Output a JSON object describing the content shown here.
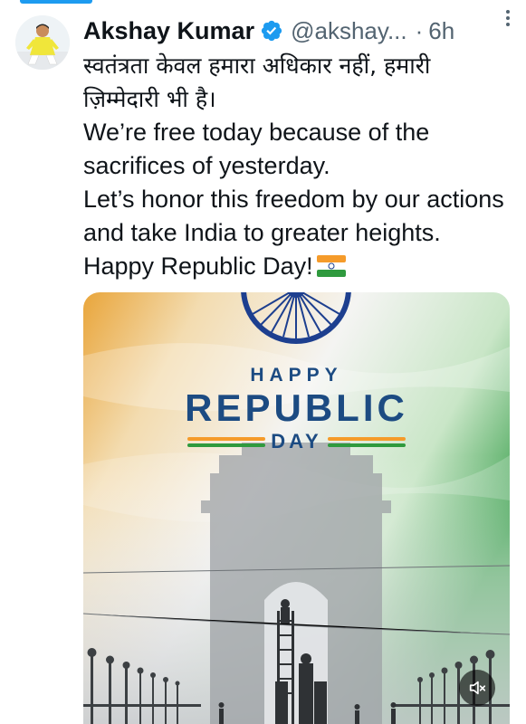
{
  "tweet": {
    "author": {
      "display_name": "Akshay Kumar",
      "handle": "@akshay...",
      "verified": true,
      "avatar_icon": "profile-photo"
    },
    "separator": "·",
    "timestamp": "6h",
    "text": {
      "hindi_line": "स्वतंत्रता केवल हमारा अधिकार नहीं, हमारी ज़िम्मेदारी भी है।",
      "english_line_1": "We’re free today because of the sacrifices of yesterday.",
      "english_line_2": "Let’s honor this freedom by our actions and take India to greater heights. Happy Republic Day!",
      "flag_emoji": "india-flag"
    },
    "media": {
      "banner_happy": "HAPPY",
      "banner_republic": "REPUBLIC",
      "banner_day": "DAY",
      "mute_icon": "speaker-muted-icon"
    }
  },
  "colors": {
    "accent": "#1d9bf0",
    "text_primary": "#0f1419",
    "text_secondary": "#536471",
    "saffron": "#f59b2a",
    "india_green": "#2f9a3e",
    "navy": "#1c4b82"
  }
}
